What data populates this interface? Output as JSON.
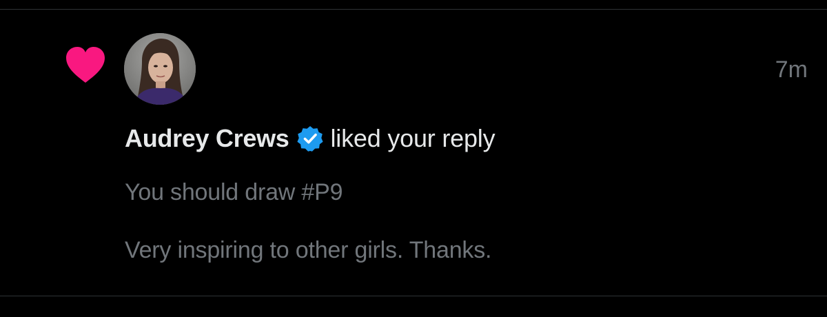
{
  "notification": {
    "type_icon": "heart-icon",
    "type_icon_color": "#f91880",
    "avatar_icon": "user-avatar",
    "user_name": "Audrey Crews",
    "verified_icon": "verified-badge-icon",
    "verified_color": "#1d9bf0",
    "action_text": "liked your reply",
    "timestamp": "7m",
    "reply_lines": [
      "You should draw #P9",
      "",
      "Very inspiring to other girls. Thanks."
    ]
  },
  "colors": {
    "background": "#000000",
    "primary_text": "#e7e9ea",
    "secondary_text": "#71767b",
    "divider": "#2f3336"
  }
}
